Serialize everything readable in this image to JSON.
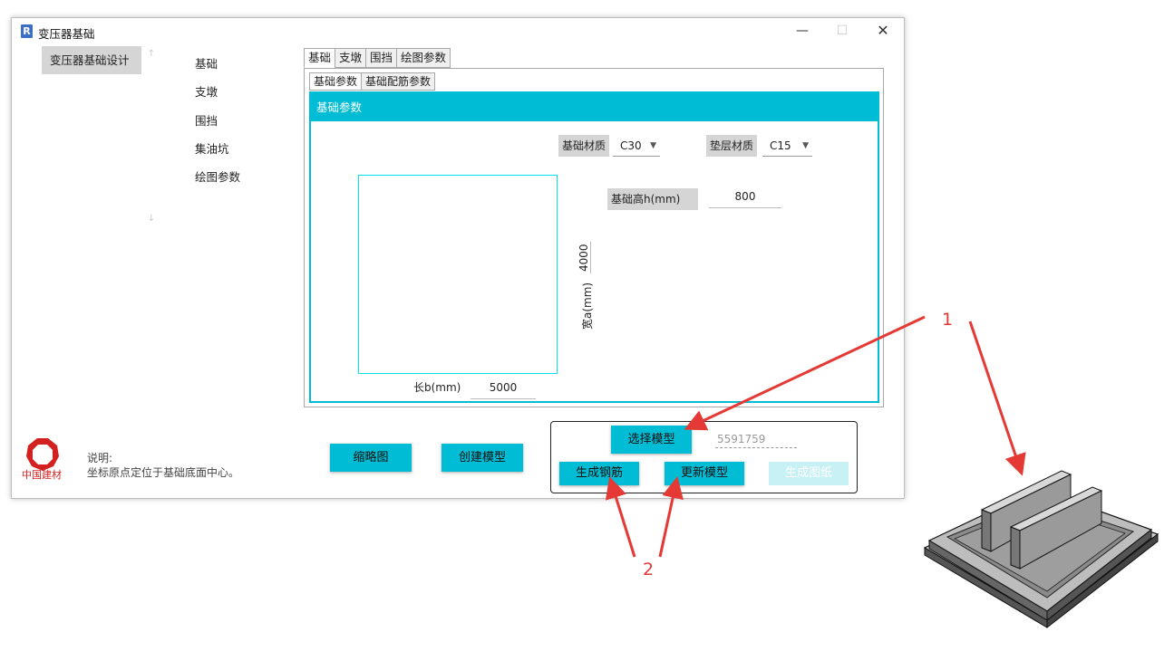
{
  "window": {
    "title": "变压器基础",
    "icon": "R",
    "controls": [
      "—",
      "☐",
      "✕"
    ]
  },
  "nav": {
    "main_label": "变压器基础设计",
    "items": [
      "基础",
      "支墩",
      "围挡",
      "集油坑",
      "绘图参数"
    ]
  },
  "tabs": {
    "top": [
      "基础",
      "支墩",
      "围挡",
      "绘图参数"
    ],
    "active_top": "基础",
    "sub": [
      "基础参数",
      "基础配筋参数"
    ],
    "active_sub": "基础参数"
  },
  "panel": {
    "header": "基础参数",
    "foundation_material_label": "基础材质",
    "foundation_material_value": "C30",
    "cushion_material_label": "垫层材质",
    "cushion_material_value": "C15",
    "height_label": "基础高h(mm)",
    "height_value": "800",
    "width_label": "宽a(mm)",
    "width_value": "4000",
    "length_label": "长b(mm)",
    "length_value": "5000"
  },
  "bottom": {
    "logo_text": "中国建材",
    "note_title": "说明:",
    "note_text": "坐标原点定位于基础底面中心。",
    "thumbnail_button": "缩略图",
    "create_model_button": "创建模型",
    "select_model_button": "选择模型",
    "model_id": "5591759",
    "generate_rebar_button": "生成钢筋",
    "update_model_button": "更新模型",
    "generate_drawing_button": "生成图纸"
  },
  "annotations": {
    "label_1": "1",
    "label_2": "2",
    "arrow_color": "#e53935"
  },
  "colors": {
    "accent": "#00bcd4",
    "accent_disabled": "#c8f1f5",
    "label_bg": "#d5d5d5"
  }
}
